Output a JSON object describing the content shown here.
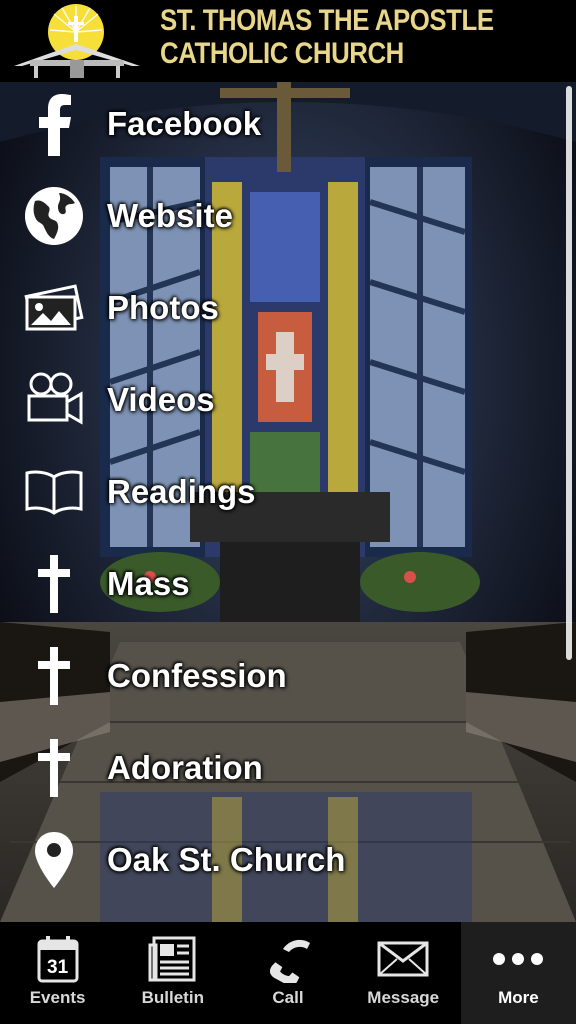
{
  "header": {
    "title_line1": "ST. THOMAS THE APOSTLE",
    "title_line2": "CATHOLIC CHURCH"
  },
  "menu": {
    "items": [
      {
        "label": "Facebook",
        "icon": "facebook-icon"
      },
      {
        "label": "Website",
        "icon": "globe-icon"
      },
      {
        "label": "Photos",
        "icon": "photos-icon"
      },
      {
        "label": "Videos",
        "icon": "video-camera-icon"
      },
      {
        "label": "Readings",
        "icon": "book-icon"
      },
      {
        "label": "Mass",
        "icon": "cross-icon"
      },
      {
        "label": "Confession",
        "icon": "cross-icon"
      },
      {
        "label": "Adoration",
        "icon": "cross-icon"
      },
      {
        "label": "Oak St. Church",
        "icon": "map-pin-icon"
      }
    ]
  },
  "tabbar": {
    "calendar_day": "31",
    "tabs": [
      {
        "label": "Events",
        "icon": "calendar-icon"
      },
      {
        "label": "Bulletin",
        "icon": "newspaper-icon"
      },
      {
        "label": "Call",
        "icon": "phone-icon"
      },
      {
        "label": "Message",
        "icon": "envelope-icon"
      },
      {
        "label": "More",
        "icon": "more-dots-icon",
        "active": true
      }
    ]
  },
  "colors": {
    "header_text": "#e8d68a",
    "sun": "#f7df3a",
    "menu_text": "#ffffff",
    "tab_active_bg": "#1e1e1e"
  }
}
